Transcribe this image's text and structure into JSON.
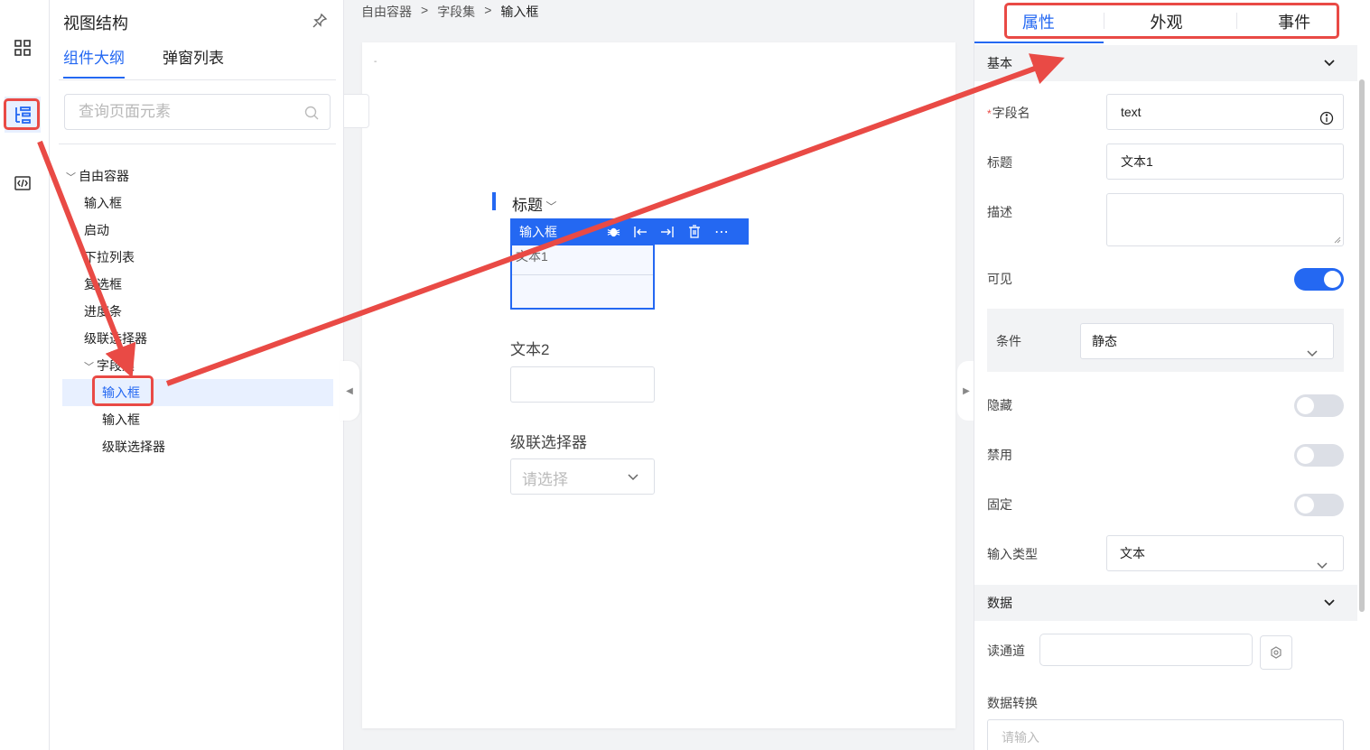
{
  "rail": {
    "icons": [
      "grid-icon",
      "outline-tree-icon",
      "code-icon"
    ]
  },
  "outline": {
    "title": "视图结构",
    "tabs": [
      "组件大纲",
      "弹窗列表"
    ],
    "search_placeholder": "查询页面元素",
    "tree": [
      {
        "label": "自由容器",
        "level": 0,
        "expanded": true
      },
      {
        "label": "输入框",
        "level": 1
      },
      {
        "label": "启动",
        "level": 1
      },
      {
        "label": "下拉列表",
        "level": 1
      },
      {
        "label": "复选框",
        "level": 1
      },
      {
        "label": "进度条",
        "level": 1
      },
      {
        "label": "级联选择器",
        "level": 1
      },
      {
        "label": "字段集",
        "level": 1,
        "expanded": true
      },
      {
        "label": "输入框",
        "level": 2,
        "selected": true
      },
      {
        "label": "输入框",
        "level": 2
      },
      {
        "label": "级联选择器",
        "level": 2
      }
    ]
  },
  "breadcrumb": {
    "items": [
      "自由容器",
      "字段集",
      "输入框"
    ],
    "separator": ">"
  },
  "canvas": {
    "dash": "-",
    "title": "标题",
    "toolbar_label": "输入框",
    "selected_field_label": "文本1",
    "field2_label": "文本2",
    "field3_label": "级联选择器",
    "field3_placeholder": "请选择"
  },
  "props": {
    "tabs": [
      "属性",
      "外观",
      "事件"
    ],
    "active_tab": "属性",
    "section_basic": "基本",
    "field_name_label": "字段名",
    "field_name_value": "text",
    "title_label": "标题",
    "title_value": "文本1",
    "desc_label": "描述",
    "desc_value": "",
    "visible_label": "可见",
    "visible": true,
    "condition_label": "条件",
    "condition_value": "静态",
    "hidden_label": "隐藏",
    "hidden": false,
    "disabled_label": "禁用",
    "disabled": false,
    "fixed_label": "固定",
    "fixed": false,
    "input_type_label": "输入类型",
    "input_type_value": "文本",
    "section_data": "数据",
    "read_channel_label": "读通道",
    "read_channel_value": "",
    "data_convert_label": "数据转换",
    "data_convert_placeholder": "请输入"
  },
  "colors": {
    "accent": "#2468f2",
    "annotation": "#e94a45"
  }
}
